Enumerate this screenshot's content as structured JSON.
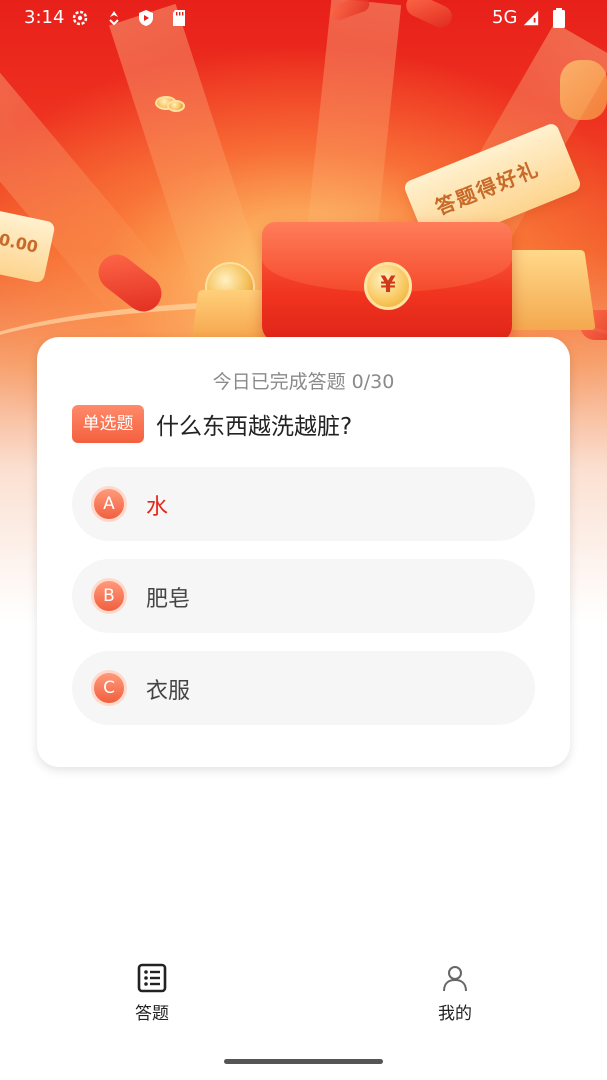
{
  "status_bar": {
    "time": "3:14",
    "network": "5G"
  },
  "hero": {
    "ticket_text": "答题得好礼",
    "ticket_left_text": "0.00",
    "yen_symbol": "¥"
  },
  "quiz": {
    "progress_text": "今日已完成答题 0/30",
    "question_type": "单选题",
    "question": "什么东西越洗越脏?",
    "options": [
      {
        "letter": "A",
        "text": "水",
        "selected": true
      },
      {
        "letter": "B",
        "text": "肥皂",
        "selected": false
      },
      {
        "letter": "C",
        "text": "衣服",
        "selected": false
      }
    ]
  },
  "bottom_nav": {
    "items": [
      {
        "label": "答题",
        "icon": "list-icon",
        "active": true
      },
      {
        "label": "我的",
        "icon": "person-icon",
        "active": false
      }
    ]
  },
  "colors": {
    "accent": "#e5261a",
    "badge": "#f3603e"
  }
}
